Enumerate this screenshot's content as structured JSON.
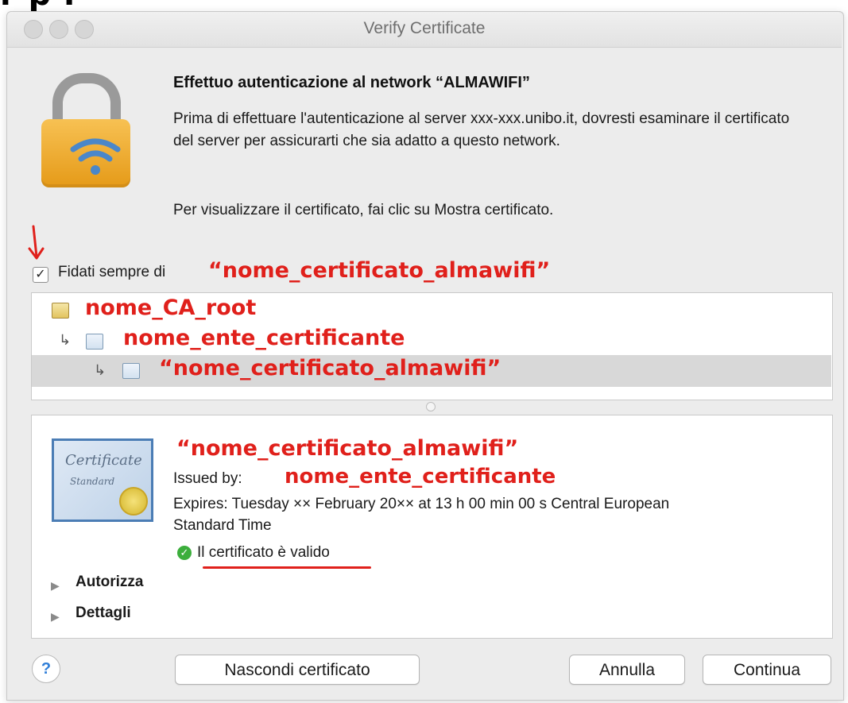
{
  "page_fragment": "r p r",
  "window": {
    "title": "Verify Certificate"
  },
  "auth": {
    "heading": "Effettuo autenticazione al network “ALMAWIFI”",
    "paragraph1": "Prima di effettuare l'autenticazione al server xxx-xxx.unibo.it, dovresti esaminare il certificato del server per assicurarti che sia adatto a questo network.",
    "paragraph2": "Per visualizzare il certificato, fai clic su Mostra certificato."
  },
  "trust": {
    "checkbox_checked": true,
    "label": "Fidati sempre di",
    "cert_name": "“nome_certificato_almawifi”"
  },
  "chain": [
    {
      "label": "nome_CA_root",
      "indent": 0
    },
    {
      "label": "nome_ente_certificante",
      "indent": 1
    },
    {
      "label": "“nome_certificato_almawifi”",
      "indent": 2,
      "selected": true
    }
  ],
  "details": {
    "cert_image_text1": "Certificate",
    "cert_image_text2": "Standard",
    "name": "“nome_certificato_almawifi”",
    "issued_by_label": "Issued by:",
    "issued_by_value": "nome_ente_certificante",
    "expires_line1": "Expires: Tuesday ×× February 20×× at 13 h 00 min 00 s Central European",
    "expires_line2": "Standard Time",
    "status": "Il certificato è valido",
    "sections": [
      "Autorizza",
      "Dettagli"
    ]
  },
  "buttons": {
    "help": "?",
    "hide_cert": "Nascondi certificato",
    "cancel": "Annulla",
    "continue": "Continua"
  },
  "colors": {
    "annotation_red": "#e0201b",
    "valid_green": "#3cae3c"
  }
}
